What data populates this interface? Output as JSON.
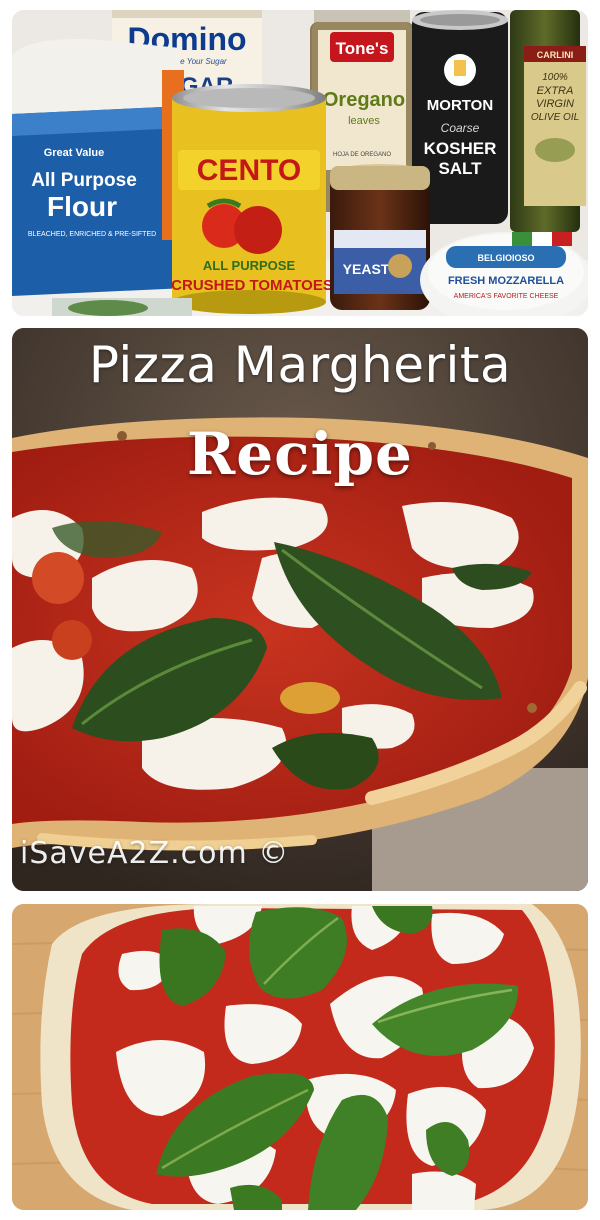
{
  "ingredients_photo": {
    "labels": {
      "sugar_brand": "Domino",
      "sugar_tagline": "Always Be Your Sugar",
      "sugar_name": "SUGAR",
      "flour_brand": "Great Value",
      "flour_name_1": "All Purpose",
      "flour_name_2": "Flour",
      "flour_desc": "BLEACHED, ENRICHED & PRE-SIFTED",
      "tomato_brand": "CENTO",
      "tomato_sub": "ALL PURPOSE",
      "tomato_name": "CRUSHED TOMATOES",
      "oregano_brand": "Tone's",
      "oregano_name": "Oregano",
      "oregano_sub": "leaves",
      "oregano_spanish": "HOJA DE OREGANO",
      "salt_brand": "MORTON",
      "salt_coarse": "Coarse",
      "salt_name_1": "KOSHER",
      "salt_name_2": "SALT",
      "yeast_name": "YEAST",
      "oil_brand": "CARLINI",
      "oil_pct": "100%",
      "oil_name_1": "EXTRA",
      "oil_name_2": "VIRGIN",
      "oil_name_3": "OLIVE OIL",
      "cheese_brand": "BELGIOIOSO",
      "cheese_name": "FRESH MOZZARELLA",
      "cheese_sub": "AMERICA'S FAVORITE CHEESE"
    }
  },
  "baked_photo": {
    "title_line_1": "Pizza Margherita",
    "title_line_2": "Recipe",
    "watermark": "iSaveA2Z.com ©"
  },
  "assembled_photo": {},
  "colors": {
    "sauce": "#b8261a",
    "mozzarella": "#f4f1ea",
    "basil": "#3d7a22",
    "crust": "#e9c98e",
    "board": "#d6a76f"
  }
}
